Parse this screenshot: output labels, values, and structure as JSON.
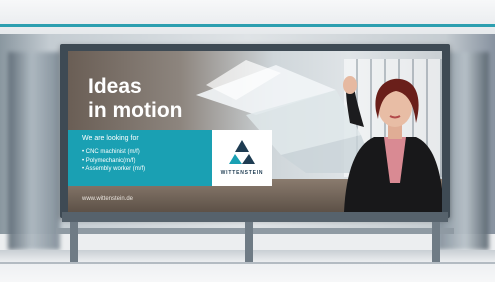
{
  "billboard": {
    "headline_line1": "Ideas",
    "headline_line2": "in motion",
    "subheading": "We are looking for",
    "jobs": [
      "• CNC machinist (m/f)",
      "• Polymechanic(m/f)",
      "• Assembly worker (m/f)"
    ],
    "url": "www.wittenstein.de",
    "logo_text": "WITTENSTEIN"
  },
  "colors": {
    "accent_teal": "#1aa0b3",
    "frame": "#3e4a54",
    "logo_blue": "#1e3c52"
  }
}
